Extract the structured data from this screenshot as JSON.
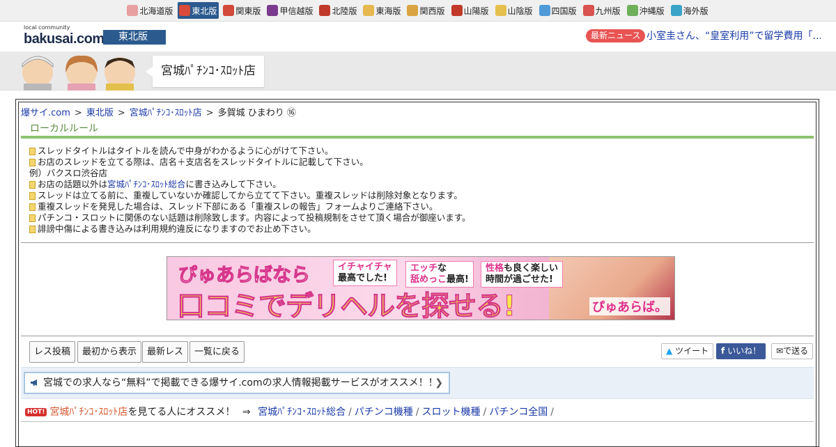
{
  "region_nav": [
    {
      "label": "北海道版",
      "color": "#e8a0a0",
      "active": false
    },
    {
      "label": "東北版",
      "color": "#d84a3a",
      "active": true
    },
    {
      "label": "関東版",
      "color": "#d24a3a",
      "active": false
    },
    {
      "label": "甲信越版",
      "color": "#7a3b8f",
      "active": false
    },
    {
      "label": "北陸版",
      "color": "#c0392b",
      "active": false
    },
    {
      "label": "東海版",
      "color": "#e6b84f",
      "active": false
    },
    {
      "label": "関西版",
      "color": "#d9a441",
      "active": false
    },
    {
      "label": "山陽版",
      "color": "#c0392b",
      "active": false
    },
    {
      "label": "山陰版",
      "color": "#e6c04f",
      "active": false
    },
    {
      "label": "四国版",
      "color": "#4f9ad9",
      "active": false
    },
    {
      "label": "九州版",
      "color": "#d9534f",
      "active": false
    },
    {
      "label": "沖縄版",
      "color": "#6fb05a",
      "active": false
    },
    {
      "label": "海外版",
      "color": "#3aa4c8",
      "active": false
    }
  ],
  "header": {
    "logo_small": "local community",
    "logo_main": "bakusai.com",
    "edition": "東北版",
    "news_badge": "最新ニュース",
    "news_text": "小室圭さん、“皇室利用”で留学費用「..."
  },
  "board": {
    "title": "宮城ﾊﾟﾁﾝｺ･ｽﾛｯﾄ店"
  },
  "breadcrumb": {
    "home": "爆サイ.com",
    "sep": ">",
    "region": "東北版",
    "board": "宮城ﾊﾟﾁﾝｺ･ｽﾛｯﾄ店",
    "current": "多賀城 ひまわり ⑯"
  },
  "rules": {
    "title": "ローカルルール",
    "line1": "スレッドタイトルはタイトルを読んで中身がわかるように心がけて下さい。",
    "line2": "お店のスレッドを立てる際は、店名＋支店名をスレッドタイトルに記載して下さい。",
    "line3": "例）バクスロ渋谷店",
    "line4_pre": "お店の話題以外は",
    "line4_link": "宮城ﾊﾟﾁﾝｺ･ｽﾛｯﾄ総合",
    "line4_post": "に書き込みして下さい。",
    "line5": "スレッドは立てる前に、重複していないか確認してから立てて下さい。重複スレッドは削除対象となります。",
    "line6": "重複スレッドを発見した場合は、スレッド下部にある「重複スレの報告」フォームよりご連絡下さい。",
    "line7": "パチンコ・スロットに関係のない話題は削除致します。内容によって投稿規制をさせて頂く場合が御座います。",
    "line8": "誹謗中傷による書き込みは利用規約違反になりますのでお止め下さい。"
  },
  "ad": {
    "line1": "ぴゅあらばなら",
    "line2": "口コミでデリヘルを探せる!",
    "bubble1_a": "イチャイチャ",
    "bubble1_b": "最高でした!",
    "bubble2_a": "エッチ",
    "bubble2_b": "な",
    "bubble2_c": "舐めっこ",
    "bubble2_d": "最高!",
    "bubble3_a": "性格",
    "bubble3_b": "も良く楽しい",
    "bubble3_c": "時間が過ごせた!",
    "logo": "ぴゅあらば。"
  },
  "toolbar": {
    "post": "レス投稿",
    "from_start": "最初から表示",
    "latest": "最新レス",
    "back": "一覧に戻る",
    "tweet": "ツイート",
    "like": "いいね！",
    "send": "で送る"
  },
  "job": {
    "text": "宮城での求人なら“無料”で掲載できる爆サイ.comの求人情報掲載サービスがオススメ！！"
  },
  "recommend": {
    "hot": "HOT!",
    "board": "宮城ﾊﾟﾁﾝｺ･ｽﾛｯﾄ店",
    "text": "を見てる人にオススメ！",
    "arrow": "⇒",
    "link1": "宮城ﾊﾟﾁﾝｺ･ｽﾛｯﾄ総合",
    "link2": "パチンコ機種",
    "link3": "スロット機種",
    "link4": "パチンコ全国",
    "slash": "/"
  }
}
